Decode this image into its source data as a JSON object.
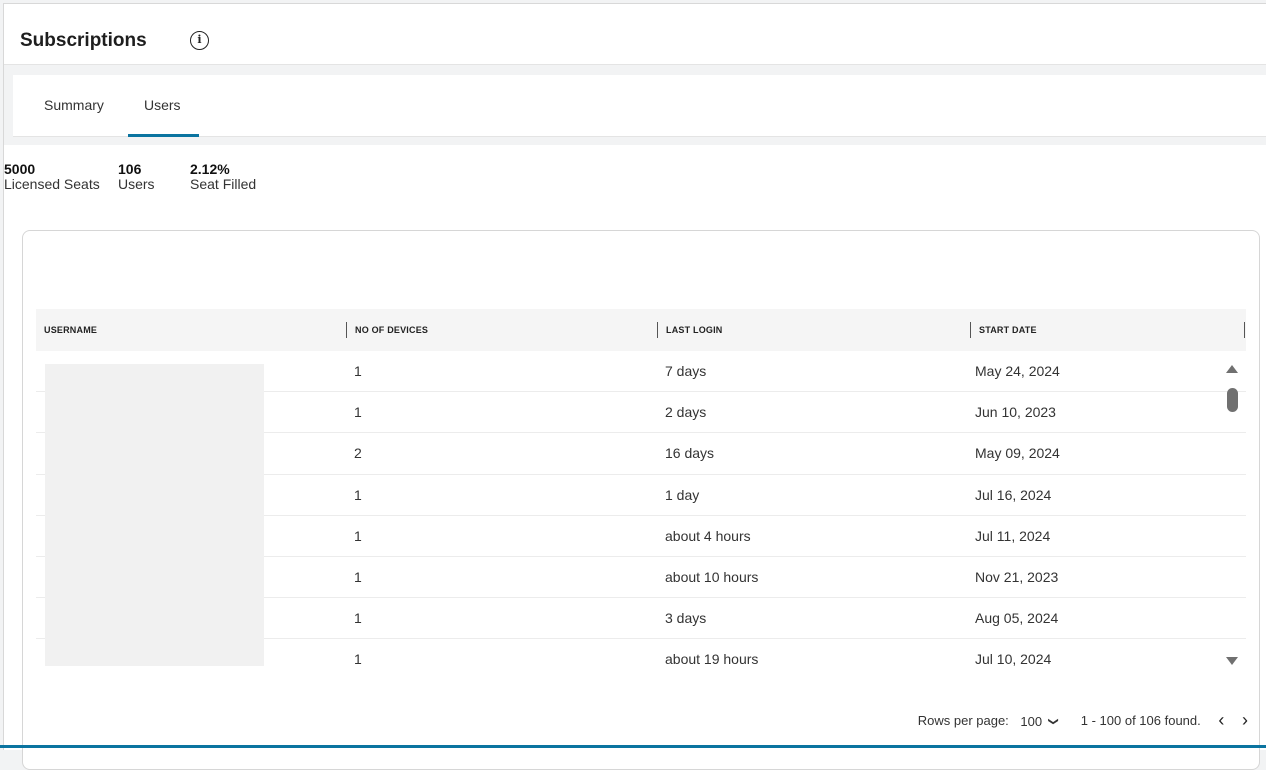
{
  "header": {
    "title": "Subscriptions",
    "info_icon": "info-icon"
  },
  "tabs": [
    {
      "label": "Summary"
    },
    {
      "label": "Users"
    }
  ],
  "stats": {
    "licensed_seats": {
      "value": "5000",
      "label": "Licensed Seats"
    },
    "users": {
      "value": "106",
      "label": "Users"
    },
    "seat_filled": {
      "value": "2.12%",
      "label": "Seat Filled"
    }
  },
  "table": {
    "columns": [
      "USERNAME",
      "NO OF DEVICES",
      "LAST LOGIN",
      "START DATE"
    ],
    "rows": [
      {
        "devices": "1",
        "last_login": "7 days",
        "start_date": "May 24, 2024"
      },
      {
        "devices": "1",
        "last_login": "2 days",
        "start_date": "Jun 10, 2023"
      },
      {
        "devices": "2",
        "last_login": "16 days",
        "start_date": "May 09, 2024"
      },
      {
        "devices": "1",
        "last_login": "1 day",
        "start_date": "Jul 16, 2024"
      },
      {
        "devices": "1",
        "last_login": "about 4 hours",
        "start_date": "Jul 11, 2024"
      },
      {
        "devices": "1",
        "last_login": "about 10 hours",
        "start_date": "Nov 21, 2023"
      },
      {
        "devices": "1",
        "last_login": "3 days",
        "start_date": "Aug 05, 2024"
      },
      {
        "devices": "1",
        "last_login": "about 19 hours",
        "start_date": "Jul 10, 2024"
      }
    ]
  },
  "pager": {
    "rows_label": "Rows per page:",
    "rows_value": "100",
    "range": "1 - 100 of 106 found."
  },
  "colors": {
    "accent": "#0b74a0"
  }
}
